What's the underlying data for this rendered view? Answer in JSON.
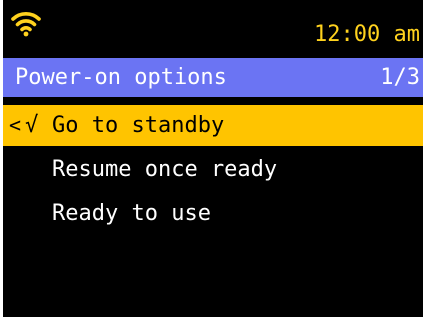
{
  "status": {
    "wifi_icon": "wifi-icon",
    "time": "12:00 am"
  },
  "header": {
    "title": "Power-on options",
    "page_indicator": "1/3"
  },
  "menu": {
    "selected_marker": {
      "back": "<",
      "check": "√"
    },
    "items": [
      {
        "label": "Go to standby",
        "selected": true
      },
      {
        "label": "Resume once ready",
        "selected": false
      },
      {
        "label": "Ready to use",
        "selected": false
      }
    ]
  },
  "colors": {
    "background": "#000000",
    "accent": "#ffd21e",
    "title_bar": "#6b74f3",
    "selection": "#ffc400",
    "text": "#ffffff"
  }
}
